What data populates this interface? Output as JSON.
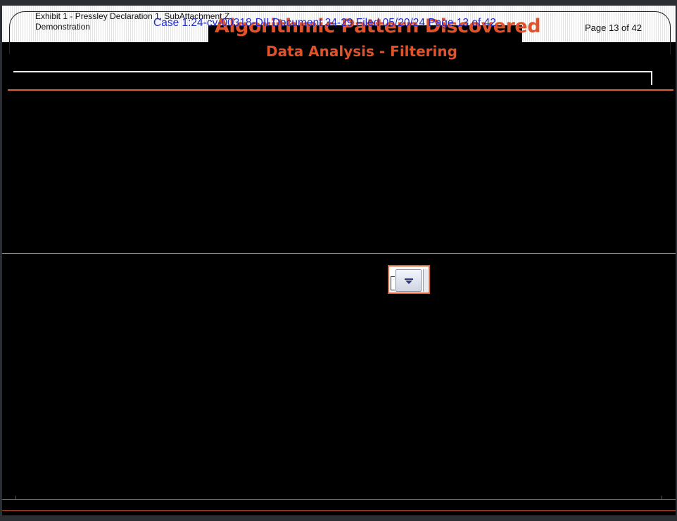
{
  "header": {
    "exhibit_line1": "Exhibit 1 - Pressley Declaration 1, SubAttachment Z",
    "exhibit_line2": "Demonstration",
    "page_label": "Page 13 of 42",
    "case_stamp": "Case 1:24-cv-00318-DII   Document 34-29   Filed 05/20/24   Page 13 of 42"
  },
  "slide": {
    "title": "Algorithmic Pattern Discovered",
    "subtitle": "Data Analysis - Filtering"
  },
  "colors": {
    "accent": "#e0522a",
    "stamp": "#1f2bd0",
    "background": "#000000"
  },
  "filter_widget": {
    "icon": "dropdown-arrow-icon"
  }
}
